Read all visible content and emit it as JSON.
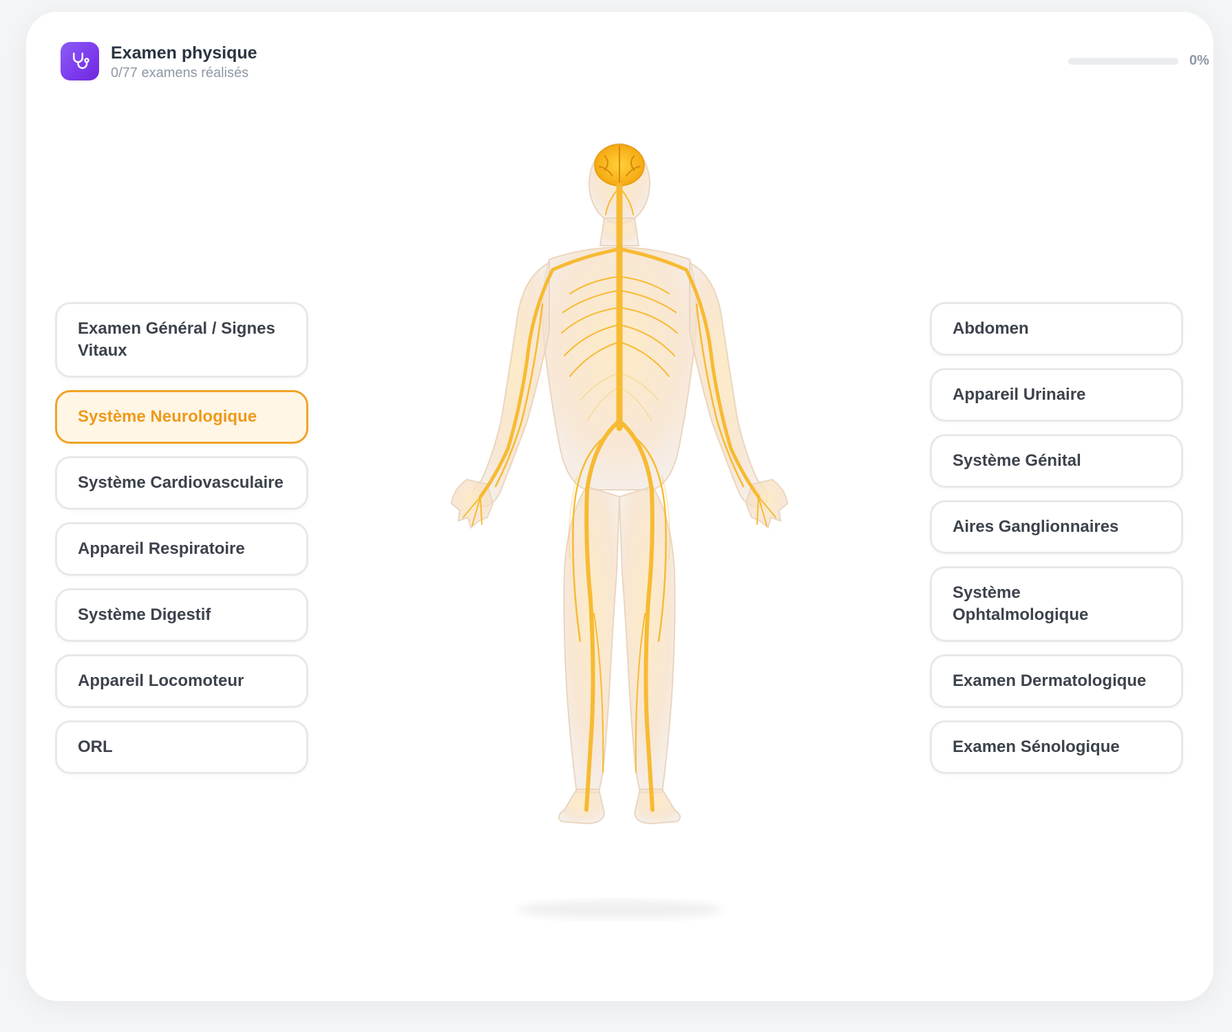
{
  "header": {
    "title": "Examen physique",
    "subtitle": "0/77 examens réalisés",
    "icon": "stethoscope-icon",
    "progress_percent": 0,
    "progress_label": "0%"
  },
  "left_systems": [
    {
      "label": "Examen Général / Signes Vitaux",
      "active": false
    },
    {
      "label": "Système Neurologique",
      "active": true
    },
    {
      "label": "Système Cardiovasculaire",
      "active": false
    },
    {
      "label": "Appareil Respiratoire",
      "active": false
    },
    {
      "label": "Système Digestif",
      "active": false
    },
    {
      "label": "Appareil Locomoteur",
      "active": false
    },
    {
      "label": "ORL",
      "active": false
    }
  ],
  "right_systems": [
    {
      "label": "Abdomen",
      "active": false
    },
    {
      "label": "Appareil Urinaire",
      "active": false
    },
    {
      "label": "Système Génital",
      "active": false
    },
    {
      "label": "Aires Ganglionnaires",
      "active": false
    },
    {
      "label": "Système Ophtalmologique",
      "active": false
    },
    {
      "label": "Examen Dermatologique",
      "active": false
    },
    {
      "label": "Examen Sénologique",
      "active": false
    }
  ],
  "colors": {
    "accent": "#f0a326",
    "accent_bg": "#fff6e6",
    "icon_gradient_start": "#8b5cf6",
    "icon_gradient_end": "#6d28d9"
  },
  "figure": {
    "icon": "human-nervous-system-illustration"
  }
}
